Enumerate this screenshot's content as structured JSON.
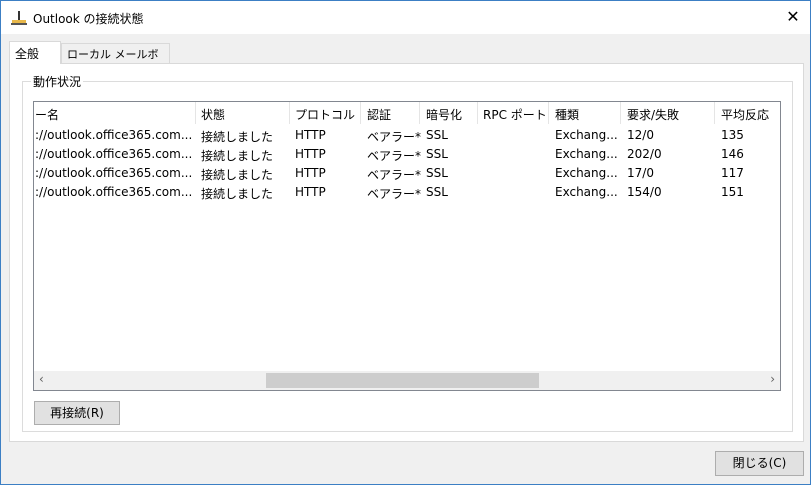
{
  "window": {
    "title": "Outlook の接続状態",
    "close_glyph": "✕"
  },
  "tabs": [
    {
      "label": "全般",
      "selected": true
    },
    {
      "label": "ローカル メールボックス",
      "selected": false
    }
  ],
  "group": {
    "label": "動作状況"
  },
  "table": {
    "columns": [
      "ー名",
      "状態",
      "プロトコル",
      "認証",
      "暗号化",
      "RPC ポート",
      "種類",
      "要求/失敗",
      "平均反応"
    ],
    "rows": [
      [
        "://outlook.office365.com...",
        "接続しました",
        "HTTP",
        "ベアラー*",
        "SSL",
        "",
        "Exchang...",
        "12/0",
        "135"
      ],
      [
        "://outlook.office365.com...",
        "接続しました",
        "HTTP",
        "ベアラー*",
        "SSL",
        "",
        "Exchang...",
        "202/0",
        "146"
      ],
      [
        "://outlook.office365.com...",
        "接続しました",
        "HTTP",
        "ベアラー*",
        "SSL",
        "",
        "Exchang...",
        "17/0",
        "117"
      ],
      [
        "://outlook.office365.com...",
        "接続しました",
        "HTTP",
        "ベアラー*",
        "SSL",
        "",
        "Exchang...",
        "154/0",
        "151"
      ]
    ],
    "scroll_left": "‹",
    "scroll_right": "›"
  },
  "buttons": {
    "reconnect": "再接続(R)",
    "close": "閉じる(C)"
  }
}
